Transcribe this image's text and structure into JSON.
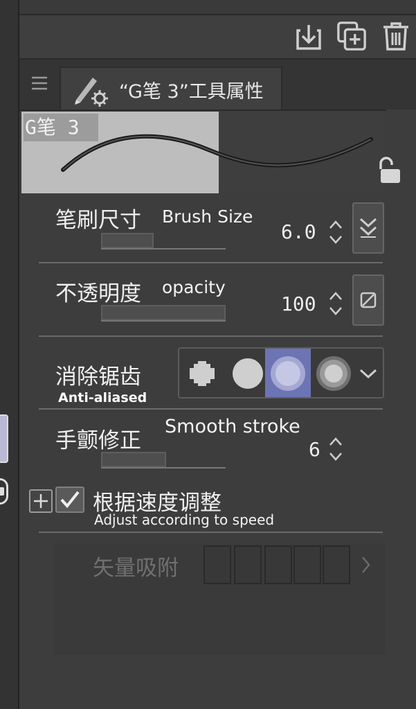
{
  "toolbar": {
    "icons": [
      "import-icon",
      "duplicate-icon",
      "trash-icon"
    ]
  },
  "tab": {
    "title": "“G笔 3”工具属性",
    "icon": "pen-settings-icon"
  },
  "preview": {
    "brush_name": "G笔 3",
    "lock_icon": "unlock-icon"
  },
  "properties": {
    "brush_size": {
      "label_cn": "笔刷尺寸",
      "label_en": "Brush Size",
      "value": "6.0",
      "slider_fraction": 0.42
    },
    "opacity": {
      "label_cn": "不透明度",
      "label_en": "opacity",
      "value": "100",
      "slider_fraction": 1.0
    },
    "anti_aliasing": {
      "label_cn": "消除锯齿",
      "label_en": "Anti-aliased",
      "options": [
        "none",
        "weak",
        "medium",
        "strong"
      ],
      "selected_index": 2
    },
    "stabilization": {
      "label_cn": "手颤修正",
      "label_en": "Smooth stroke",
      "value": "6",
      "slider_fraction": 0.52
    },
    "speed_adjust": {
      "label_cn": "根据速度调整",
      "label_en": "Adjust according to speed",
      "checked": true
    },
    "vector_snap": {
      "label_cn": "矢量吸附"
    }
  },
  "colors": {
    "background": "#3d3d3d",
    "selected_option": "#6d74b4",
    "text": "#f0f0f0"
  }
}
